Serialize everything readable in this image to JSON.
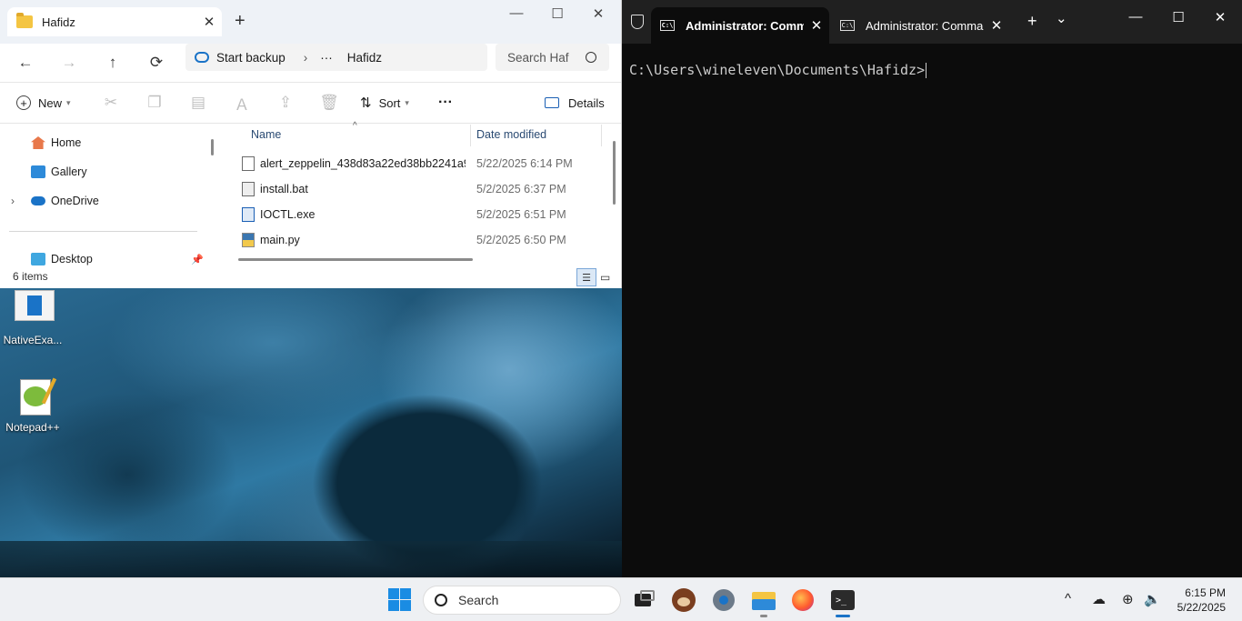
{
  "explorer": {
    "tab_title": "Hafidz",
    "tab_close": "✕",
    "new_tab": "+",
    "window_controls": {
      "minimize": "—",
      "maximize": "☐",
      "close": "✕"
    },
    "nav": {
      "back": "←",
      "forward": "→",
      "up": "↑",
      "refresh": "⟳"
    },
    "address": {
      "backup_label": "Start backup",
      "chevron": "›",
      "ellipsis": "···",
      "folder": "Hafidz"
    },
    "search_placeholder": "Search Haf",
    "toolbar": {
      "new_label": "New",
      "sort_label": "Sort",
      "more": "···",
      "details_label": "Details"
    },
    "nav_pane": [
      {
        "label": "Home",
        "icon": "home-icon"
      },
      {
        "label": "Gallery",
        "icon": "gallery-icon"
      },
      {
        "label": "OneDrive",
        "icon": "onedrive-icon"
      },
      {
        "label": "Desktop",
        "icon": "desktop-icon"
      }
    ],
    "columns": {
      "name": "Name",
      "date": "Date modified"
    },
    "files": [
      {
        "name": "alert_zeppelin_438d83a22ed38bb2241a99...",
        "date": "5/22/2025 6:14 PM",
        "icon": "file-icon"
      },
      {
        "name": "install.bat",
        "date": "5/2/2025 6:37 PM",
        "icon": "batch-file-icon"
      },
      {
        "name": "IOCTL.exe",
        "date": "5/2/2025 6:51 PM",
        "icon": "exe-file-icon"
      },
      {
        "name": "main.py",
        "date": "5/2/2025 6:50 PM",
        "icon": "python-file-icon"
      }
    ],
    "status": "6 items"
  },
  "desktop": {
    "icons": [
      {
        "label": "NativeExa...",
        "icon": "native-app-icon"
      },
      {
        "label": "Notepad++",
        "icon": "notepadpp-icon"
      }
    ]
  },
  "terminal": {
    "tabs": [
      {
        "title": "Administrator: Comma",
        "active": true
      },
      {
        "title": "Administrator: Comma",
        "active": false
      }
    ],
    "new_tab": "+",
    "dropdown": "⌄",
    "close_tab": "✕",
    "window_controls": {
      "minimize": "—",
      "maximize": "☐",
      "close": "✕"
    },
    "prompt": "C:\\Users\\wineleven\\Documents\\Hafidz>"
  },
  "taskbar": {
    "search_label": "Search",
    "apps": [
      "start-icon",
      "task-view-icon",
      "bear-app-icon",
      "settings-icon",
      "file-explorer-icon",
      "firefox-icon",
      "terminal-icon"
    ],
    "tray": {
      "chevron": "^",
      "clock_time": "6:15 PM",
      "clock_date": "5/22/2025"
    }
  }
}
